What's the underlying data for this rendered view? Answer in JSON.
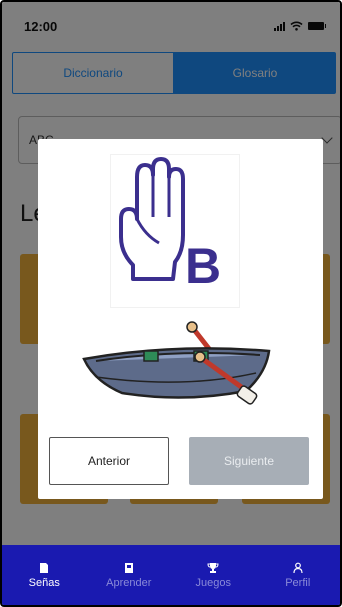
{
  "status_bar": {
    "time": "12:00"
  },
  "tabs": {
    "dictionary": "Diccionario",
    "glossary": "Glosario"
  },
  "filter": {
    "selected": "ABC"
  },
  "section": {
    "title": "Letras"
  },
  "modal": {
    "letter": "B",
    "prev_label": "Anterior",
    "next_label": "Siguiente"
  },
  "bottom_nav": {
    "items": [
      {
        "label": "Señas",
        "icon": "card-icon"
      },
      {
        "label": "Aprender",
        "icon": "book-icon"
      },
      {
        "label": "Juegos",
        "icon": "trophy-icon"
      },
      {
        "label": "Perfil",
        "icon": "person-icon"
      }
    ]
  },
  "colors": {
    "primary": "#1e90ff",
    "nav_bg": "#1a1ab0",
    "card": "#f0b03a",
    "sign_purple": "#3b2f8e",
    "disabled_button": "#a7aeb6"
  }
}
